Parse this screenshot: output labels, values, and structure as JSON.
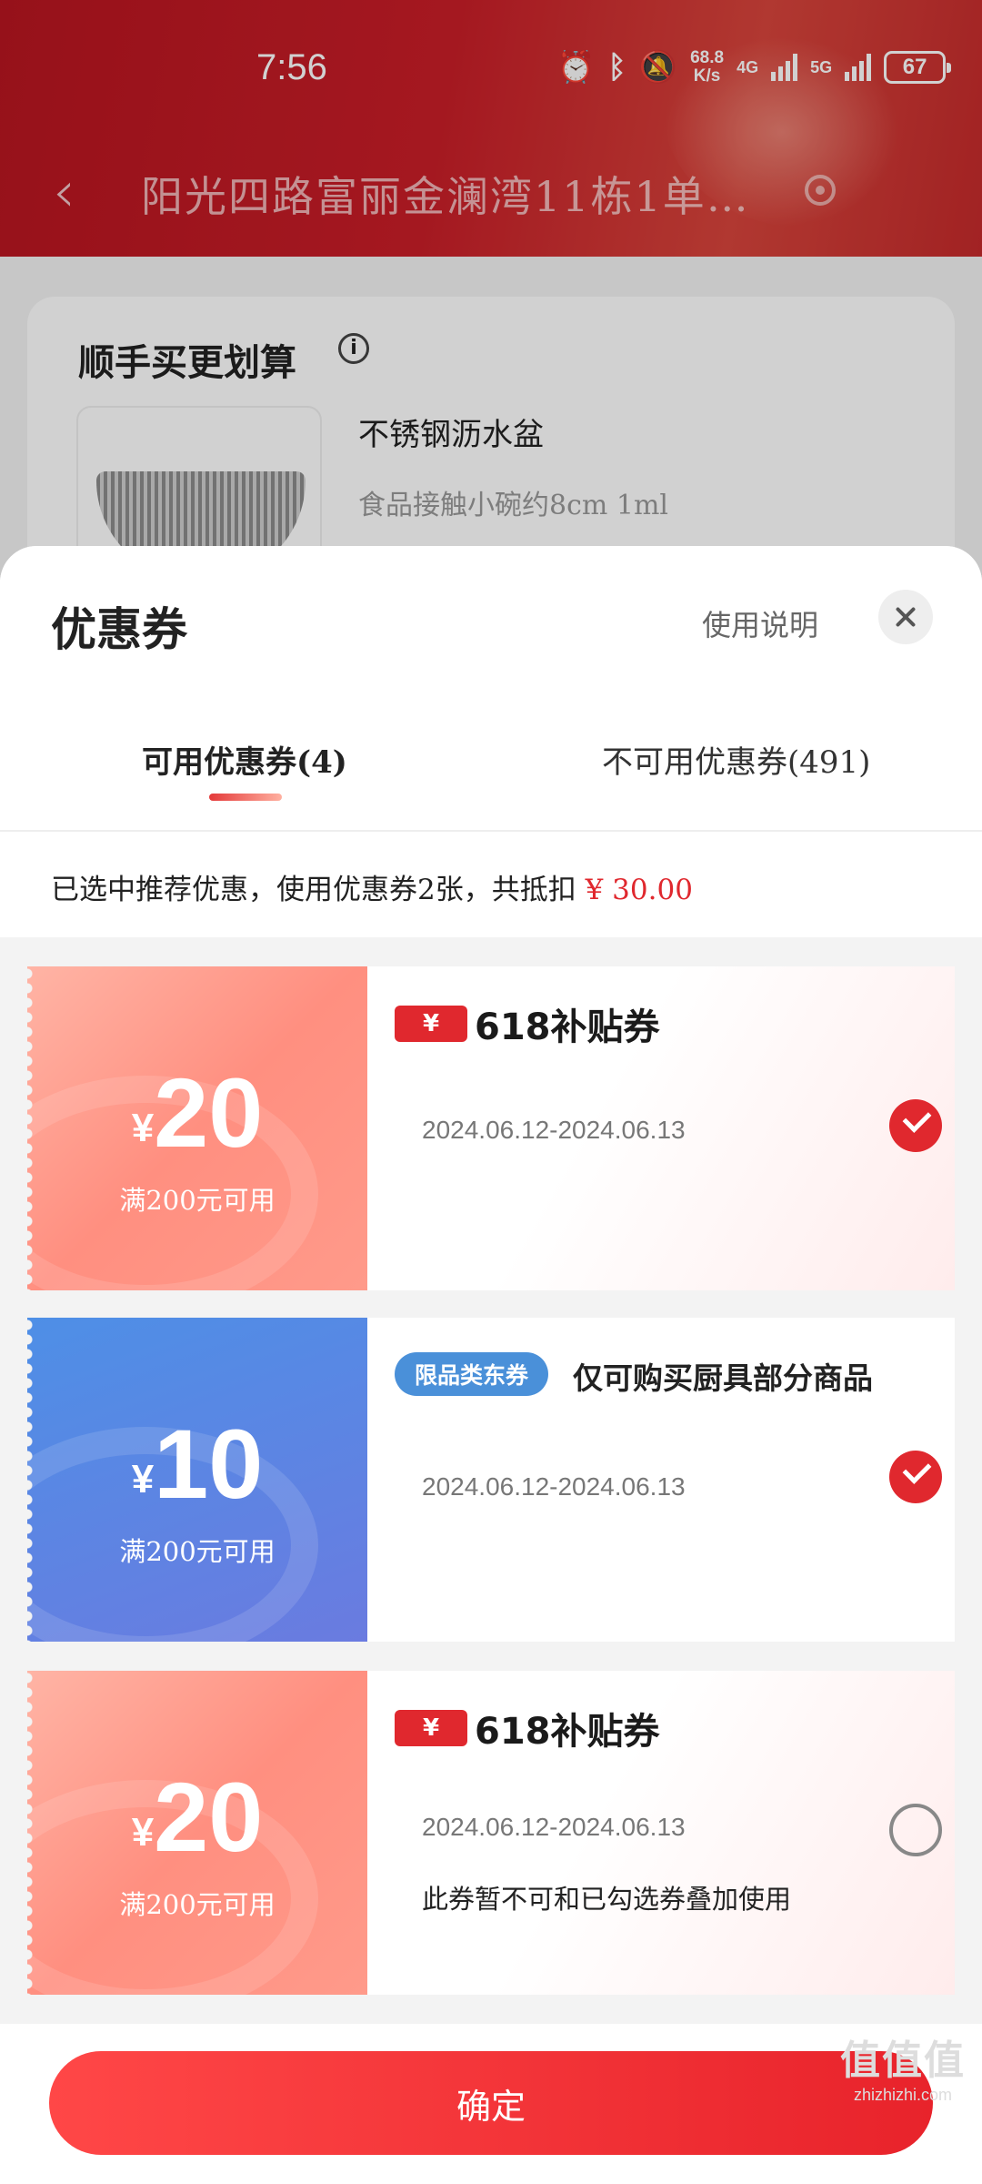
{
  "status_bar": {
    "time": "7:56",
    "speed_top": "68.8",
    "speed_bottom": "K/s",
    "net1": "4G",
    "net2": "5G",
    "battery": "67"
  },
  "header": {
    "address": "阳光四路富丽金澜湾11栋1单…"
  },
  "background_card": {
    "title": "顺手买更划算",
    "product_name": "不锈钢沥水盆",
    "product_desc": "食品接触小碗约8cm 1ml"
  },
  "sheet": {
    "title": "优惠券",
    "help_link": "使用说明",
    "tabs": [
      {
        "label": "可用优惠券(4)",
        "active": true
      },
      {
        "label": "不可用优惠券(491)",
        "active": false
      }
    ],
    "summary_text": "已选中推荐优惠，使用优惠券2张，共抵扣",
    "summary_amount": "¥ 30.00"
  },
  "coupons": [
    {
      "currency": "¥",
      "amount": "20",
      "condition": "满200元可用",
      "badge_yen": "¥",
      "badge_label": "618补贴券",
      "validity": "2024.06.12-2024.06.13",
      "selected": true
    },
    {
      "currency": "¥",
      "amount": "10",
      "condition": "满200元可用",
      "category_pill": "限品类东券",
      "restriction": "仅可购买厨具部分商品",
      "validity": "2024.06.12-2024.06.13",
      "selected": true
    },
    {
      "currency": "¥",
      "amount": "20",
      "condition": "满200元可用",
      "badge_yen": "¥",
      "badge_label": "618补贴券",
      "validity": "2024.06.12-2024.06.13",
      "note": "此券暂不可和已勾选券叠加使用",
      "selected": false
    }
  ],
  "footer": {
    "confirm_label": "确定"
  },
  "watermark": {
    "big": "值值值",
    "small": "zhizhizhi.com"
  },
  "colors": {
    "accent_red": "#e0282e",
    "pill_blue": "#4a90d9",
    "header_red": "#c91e28"
  }
}
